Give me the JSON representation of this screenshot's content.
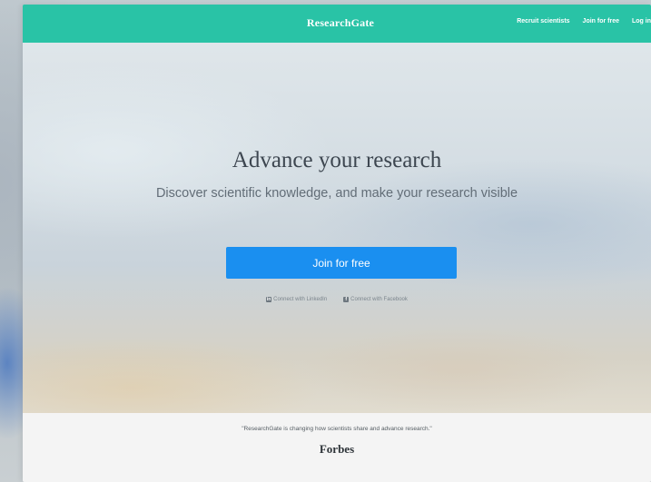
{
  "header": {
    "brand": "ResearchGate",
    "nav_links": [
      {
        "label": "Recruit scientists"
      },
      {
        "label": "Join for free"
      },
      {
        "label": "Log in"
      }
    ]
  },
  "hero": {
    "title": "Advance your research",
    "subtitle": "Discover scientific knowledge, and make your research visible",
    "join_button": "Join for free",
    "connect_links": [
      {
        "label": "Connect with LinkedIn",
        "icon": "linkedin-icon"
      },
      {
        "label": "Connect with Facebook",
        "icon": "facebook-icon"
      }
    ]
  },
  "testimonial": {
    "quote": "\"ResearchGate is changing how scientists share and advance research.\"",
    "source": "Forbes"
  },
  "colors": {
    "nav_background": "#29c3a6",
    "primary_button": "#1a8ff0",
    "testimonial_background": "#f4f4f4"
  }
}
